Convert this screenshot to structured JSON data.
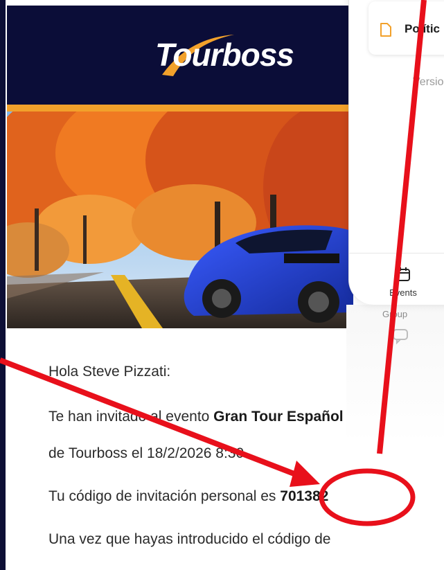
{
  "email": {
    "brand": "Tourboss",
    "greeting": "Hola Steve Pizzati:",
    "invite_prefix": "Te han invitado al evento ",
    "event_name": "Gran Tour Español",
    "invite_line2": "de Tourboss el 18/2/2026 8:30.",
    "code_prefix": "Tu código de invitación personal es ",
    "invitation_code": "701382",
    "followup": "Una vez que hayas introducido el código de"
  },
  "app": {
    "policy_label": "Polític",
    "version_text": "Versio",
    "tab_events_label": "Events",
    "tab_group_label": "Group"
  },
  "colors": {
    "banner": "#0b0d38",
    "stripe": "#f2a12b",
    "annotation_red": "#e8101b"
  },
  "icons": {
    "policy": "document-icon",
    "events": "calendar-icon",
    "group": "chat-icon"
  }
}
